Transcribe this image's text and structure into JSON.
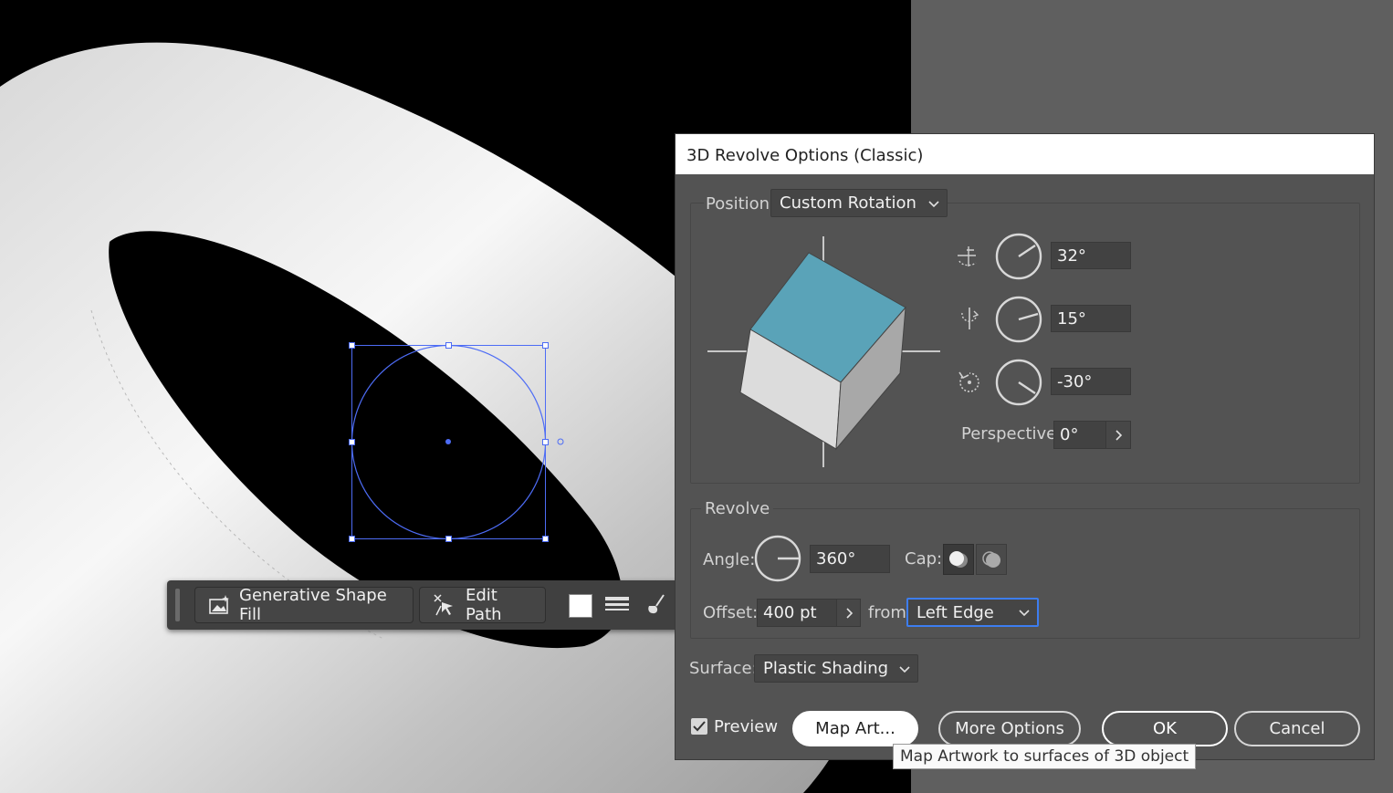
{
  "taskbar": {
    "generative_shape_fill": "Generative Shape Fill",
    "edit_path": "Edit Path"
  },
  "dialog": {
    "title": "3D Revolve Options (Classic)",
    "position_label": "Position:",
    "position_value": "Custom Rotation",
    "rotation_x": "32°",
    "rotation_y": "15°",
    "rotation_z": "-30°",
    "perspective_label": "Perspective:",
    "perspective_value": "0°",
    "revolve_group_label": "Revolve",
    "angle_label": "Angle:",
    "angle_value": "360°",
    "cap_label": "Cap:",
    "offset_label": "Offset:",
    "offset_value": "400 pt",
    "from_label": "from",
    "from_value": "Left Edge",
    "surface_label": "Surface:",
    "surface_value": "Plastic Shading",
    "preview_label": "Preview",
    "preview_checked": true,
    "map_art_label": "Map Art...",
    "more_options_label": "More Options",
    "ok_label": "OK",
    "cancel_label": "Cancel"
  },
  "tooltip": {
    "text": "Map Artwork to surfaces of 3D object"
  },
  "colors": {
    "cube_top": "#5aa3b8",
    "selection": "#4d6cf5",
    "dialog_bg": "#535353"
  }
}
